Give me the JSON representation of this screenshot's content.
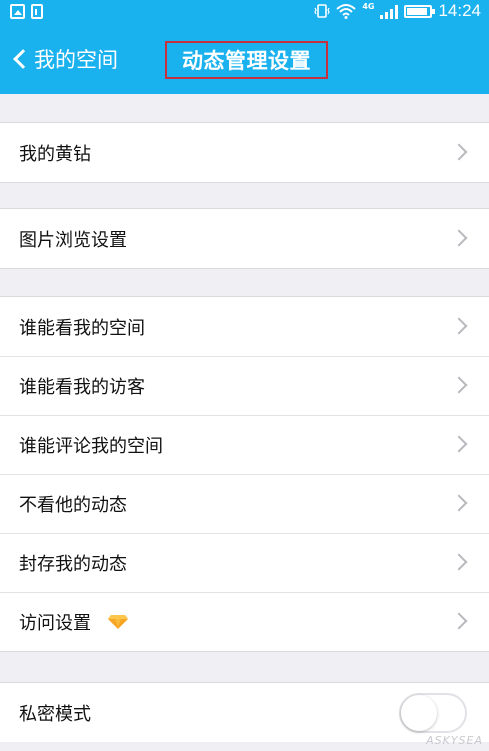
{
  "status_bar": {
    "network": "4G",
    "time": "14:24"
  },
  "nav": {
    "back_label": "我的空间",
    "title": "动态管理设置"
  },
  "groups": [
    {
      "items": [
        {
          "label": "我的黄钻"
        }
      ]
    },
    {
      "items": [
        {
          "label": "图片浏览设置"
        }
      ]
    },
    {
      "items": [
        {
          "label": "谁能看我的空间"
        },
        {
          "label": "谁能看我的访客"
        },
        {
          "label": "谁能评论我的空间"
        },
        {
          "label": "不看他的动态"
        },
        {
          "label": "封存我的动态"
        },
        {
          "label": "访问设置",
          "badge_icon": "yellow-diamond-icon"
        }
      ]
    },
    {
      "items": [
        {
          "label": "私密模式",
          "toggle": false
        }
      ]
    }
  ],
  "watermark": "ASKYSEA",
  "colors": {
    "header": "#19b1ee",
    "page_bg": "#efeff4",
    "highlight_border": "#c8303d",
    "diamond": "#f6a623"
  }
}
